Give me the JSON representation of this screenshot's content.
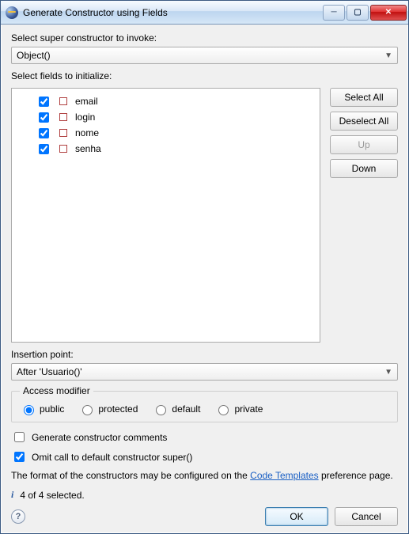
{
  "window": {
    "title": "Generate Constructor using Fields"
  },
  "labels": {
    "super_label": "Select super constructor to invoke:",
    "fields_label": "Select fields to initialize:",
    "insertion_label": "Insertion point:",
    "access_legend": "Access modifier",
    "hint_prefix": "The format of the constructors may be configured on the ",
    "hint_link": "Code Templates",
    "hint_suffix": " preference page.",
    "status": "4 of 4 selected."
  },
  "combos": {
    "super_value": "Object()",
    "insertion_value": "After 'Usuario()'"
  },
  "fields": [
    {
      "name": "email",
      "checked": true
    },
    {
      "name": "login",
      "checked": true
    },
    {
      "name": "nome",
      "checked": true
    },
    {
      "name": "senha",
      "checked": true
    }
  ],
  "sidebuttons": {
    "select_all": "Select All",
    "deselect_all": "Deselect All",
    "up": "Up",
    "down": "Down"
  },
  "radios": {
    "public": "public",
    "protected": "protected",
    "default": "default",
    "private": "private"
  },
  "checkboxes": {
    "gen_comments": "Generate constructor comments",
    "omit_super": "Omit call to default constructor super()"
  },
  "footer": {
    "ok": "OK",
    "cancel": "Cancel"
  }
}
